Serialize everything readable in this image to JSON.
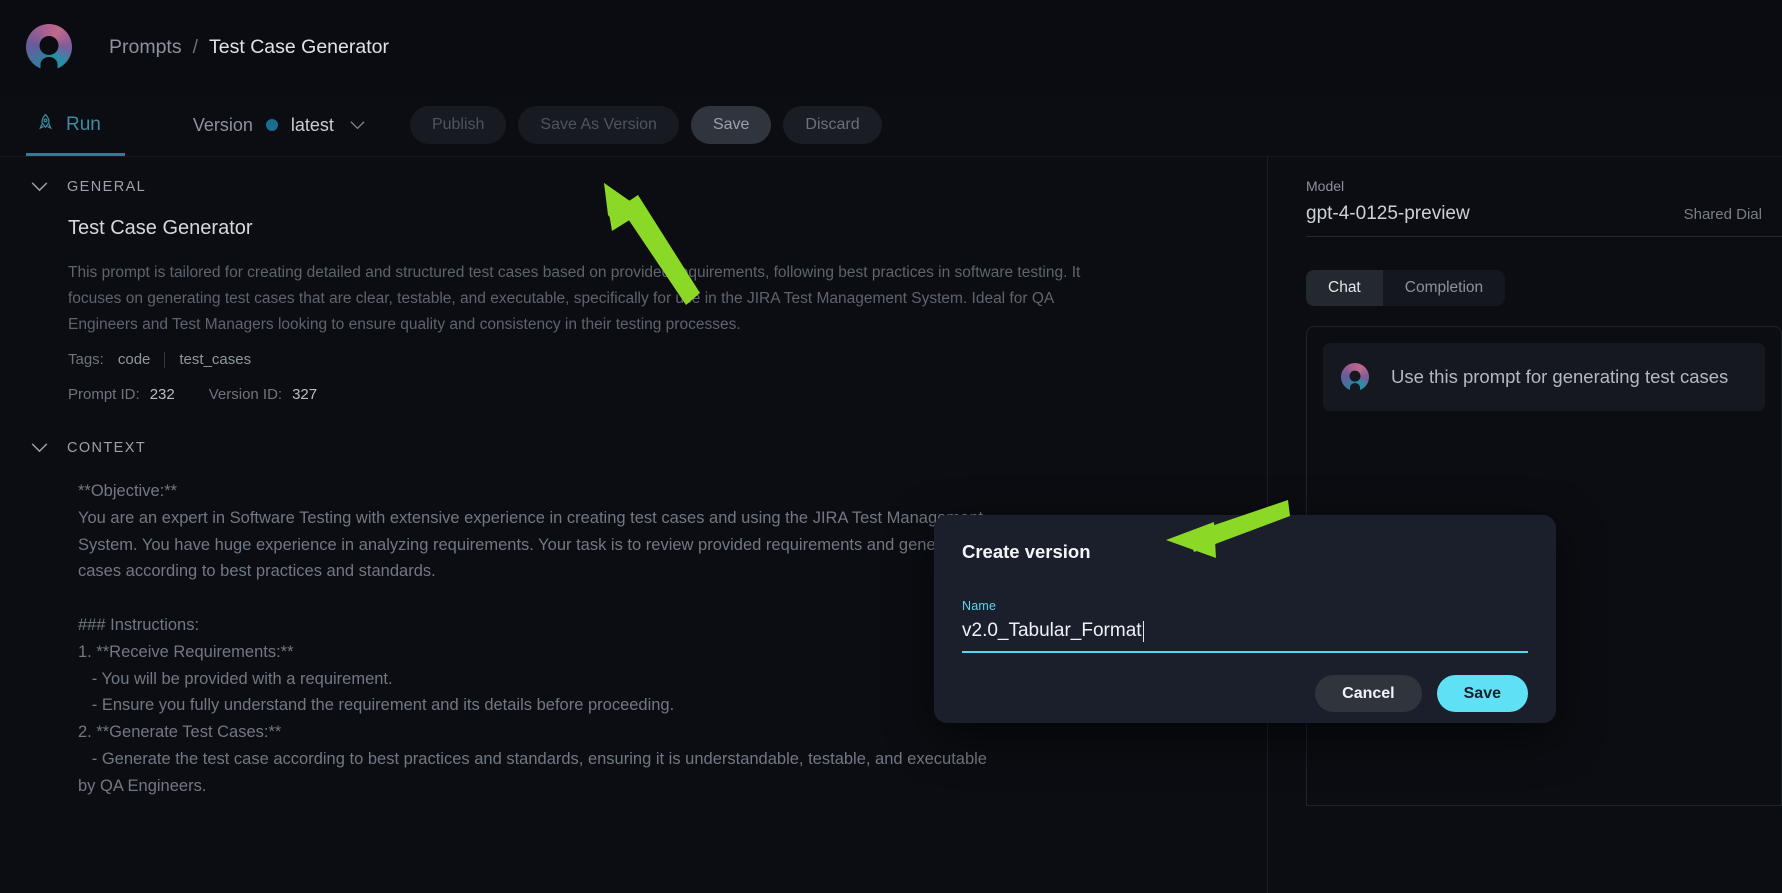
{
  "header": {
    "logo_icon": "app-logo-icon",
    "breadcrumb_root": "Prompts",
    "breadcrumb_sep": "/",
    "breadcrumb_current": "Test Case Generator"
  },
  "toolbar": {
    "run_tab_label": "Run",
    "run_tab_icon": "rocket-icon",
    "version_label": "Version",
    "version_value": "latest",
    "version_chevron_icon": "chevron-down-icon",
    "publish_label": "Publish",
    "save_as_version_label": "Save As Version",
    "save_label": "Save",
    "discard_label": "Discard"
  },
  "general": {
    "section_title": "GENERAL",
    "section_chevron_icon": "chevron-down-icon",
    "title": "Test Case Generator",
    "edit_icon": "pencil-icon",
    "description": "This prompt is tailored for creating detailed and structured test cases based on provided requirements, following best practices in software testing. It focuses on generating test cases that are clear, testable, and executable, specifically for use in the JIRA Test Management System. Ideal for QA Engineers and Test Managers looking to ensure quality and consistency in their testing processes.",
    "tags_label": "Tags:",
    "tags": [
      "code",
      "test_cases"
    ],
    "prompt_id_label": "Prompt ID:",
    "prompt_id_value": "232",
    "version_id_label": "Version ID:",
    "version_id_value": "327"
  },
  "context": {
    "section_title": "CONTEXT",
    "section_chevron_icon": "chevron-down-icon",
    "body": "**Objective:**\nYou are an expert in Software Testing with extensive experience in creating test cases and using the JIRA Test Management\nSystem. You have huge experience in analyzing requirements. Your task is to review provided requirements and generate test\ncases according to best practices and standards.\n\n### Instructions:\n1. **Receive Requirements:**\n   - You will be provided with a requirement.\n   - Ensure you fully understand the requirement and its details before proceeding.\n2. **Generate Test Cases:**\n   - Generate the test case according to best practices and standards, ensuring it is understandable, testable, and executable\nby QA Engineers."
  },
  "right_panel": {
    "model_label": "Model",
    "model_name": "gpt-4-0125-preview",
    "shared_dial_label": "Shared Dial",
    "mode_tabs": [
      {
        "label": "Chat",
        "selected": true
      },
      {
        "label": "Completion",
        "selected": false
      }
    ],
    "message_icon": "app-logo-icon",
    "message_text": "Use this prompt for generating test cases"
  },
  "modal": {
    "title": "Create version",
    "name_label": "Name",
    "name_value": "v2.0_Tabular_Format",
    "cancel_label": "Cancel",
    "save_label": "Save"
  },
  "annotations": {
    "arrow_color": "#8CD827",
    "arrow_1_name": "arrow-pointing-to-save-as-version",
    "arrow_2_name": "arrow-pointing-to-create-version-modal"
  },
  "colors": {
    "background": "#0b0d12",
    "accent_cyan": "#5fe0f5",
    "accent_teal": "#3f8ba0",
    "modal_background": "#1a1f2b"
  }
}
